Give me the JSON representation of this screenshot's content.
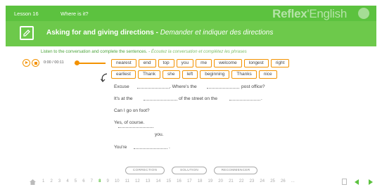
{
  "header": {
    "lesson": "Lesson 16",
    "section": "Where is it?",
    "brand_bold": "Reflex",
    "brand_rest": "'English"
  },
  "title": {
    "english": "Asking for and giving directions - ",
    "french": "Demander et indiquer des directions"
  },
  "instructions": {
    "english": "Listen to the conversation and complete the sentences. - ",
    "french": "Écoutez la conversation et complétez les phrases"
  },
  "player": {
    "time": "0:00 / 00:11",
    "progress": 0
  },
  "word_bank": {
    "row1": [
      "nearest",
      "end",
      "top",
      "you",
      "me",
      "welcome",
      "longest",
      "right"
    ],
    "row2": [
      "earliest",
      "Thank",
      "she",
      "left",
      "beginning",
      "Thanks",
      "nice"
    ]
  },
  "exercise": {
    "l1_a": "Excuse",
    "l1_b": ". Where's the",
    "l1_c": "post office?",
    "l2_a": "It's at the",
    "l2_b": "of the street on the",
    "l2_c": ".",
    "l3": "Can I go on foot?",
    "l4": "Yes, of course.",
    "l5": "you.",
    "l6_a": "You're",
    "l6_b": "."
  },
  "actions": {
    "correction": "CORRECTION",
    "solution": "SOLUTION",
    "restart": "RECOMMENCER"
  },
  "pager": {
    "pages": [
      "1",
      "2",
      "3",
      "4",
      "5",
      "6",
      "7",
      "8",
      "9",
      "10",
      "11",
      "12",
      "13",
      "14",
      "15",
      "16",
      "17",
      "18",
      "19",
      "20",
      "21",
      "22",
      "23",
      "24",
      "25",
      "26"
    ],
    "current_page": "8",
    "ellipsis": "..."
  },
  "colors": {
    "green": "#5cc23f",
    "orange": "#f39200"
  }
}
